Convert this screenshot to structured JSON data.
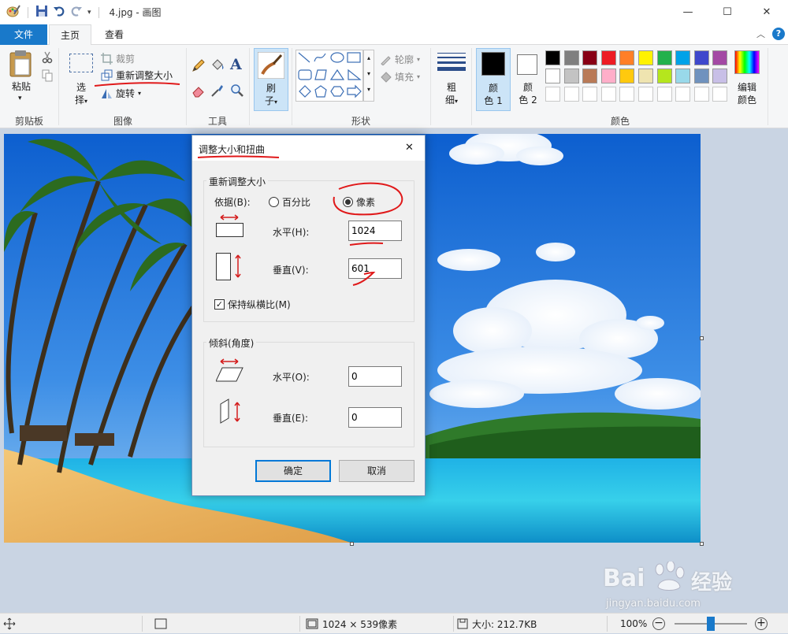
{
  "window": {
    "title": "4.jpg - 画图",
    "minimize": "—",
    "maximize": "☐",
    "close": "✕"
  },
  "tabs": {
    "file": "文件",
    "home": "主页",
    "view": "查看"
  },
  "ribbon": {
    "clipboard": {
      "paste": "粘贴",
      "group": "剪贴板"
    },
    "image": {
      "select_1": "选",
      "select_2": "择",
      "crop": "裁剪",
      "resize": "重新调整大小",
      "rotate": "旋转",
      "group": "图像"
    },
    "tools": {
      "group": "工具"
    },
    "brushes": {
      "label_1": "刷",
      "label_2": "子"
    },
    "shapes": {
      "outline": "轮廓",
      "fill": "填充",
      "group": "形状"
    },
    "size": {
      "label_1": "粗",
      "label_2": "细"
    },
    "color1": {
      "label_1": "颜",
      "label_2": "色 1",
      "value": "#000000"
    },
    "color2": {
      "label_1": "颜",
      "label_2": "色 2",
      "value": "#ffffff"
    },
    "colors": {
      "group": "颜色",
      "edit_1": "编辑",
      "edit_2": "颜色",
      "row1": [
        "#000000",
        "#7f7f7f",
        "#880015",
        "#ed1c24",
        "#ff7f27",
        "#fff200",
        "#22b14c",
        "#00a2e8",
        "#3f48cc",
        "#a349a4"
      ],
      "row2": [
        "#ffffff",
        "#c3c3c3",
        "#b97a57",
        "#ffaec9",
        "#ffc90e",
        "#efe4b0",
        "#b5e61d",
        "#99d9ea",
        "#7092be",
        "#c8bfe7"
      ]
    }
  },
  "dialog": {
    "title": "调整大小和扭曲",
    "close": "✕",
    "resize_group": "重新调整大小",
    "by_label": "依据(B):",
    "percent": "百分比",
    "pixels": "像素",
    "horizontal_label": "水平(H):",
    "horizontal_value": "1024",
    "vertical_label": "垂直(V):",
    "vertical_value": "601",
    "keep_ratio": "保持纵横比(M)",
    "skew_group": "倾斜(角度)",
    "skew_h_label": "水平(O):",
    "skew_h_value": "0",
    "skew_v_label": "垂直(E):",
    "skew_v_value": "0",
    "ok": "确定",
    "cancel": "取消"
  },
  "status": {
    "dimensions": "1024 × 539像素",
    "size": "大小: 212.7KB",
    "zoom": "100%",
    "zoom_level": 0.5
  },
  "watermark": {
    "brand": "Bai",
    "brand2": "经验",
    "url": "jingyan.baidu.com"
  }
}
